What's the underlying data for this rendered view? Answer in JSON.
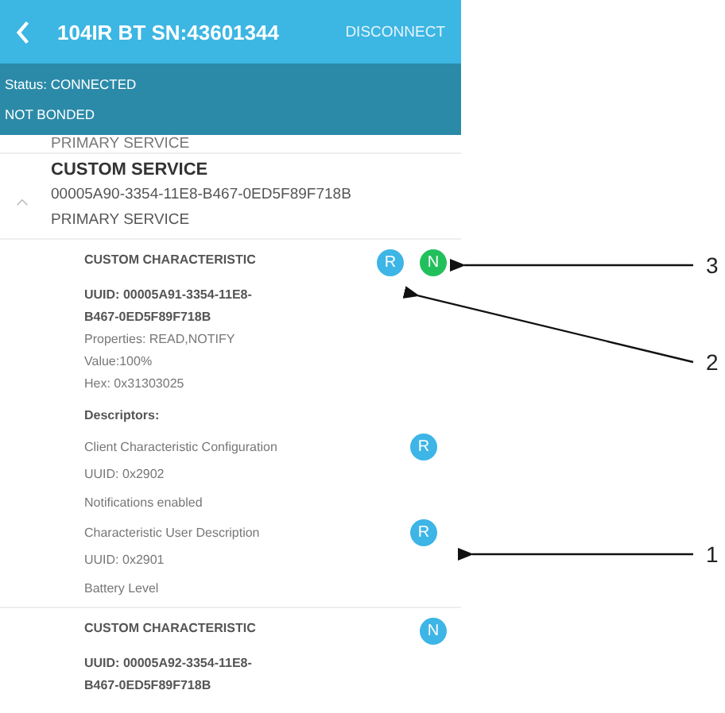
{
  "header": {
    "title": "104IR BT SN:43601344",
    "action": "DISCONNECT"
  },
  "status": [
    "Status: CONNECTED",
    "NOT BONDED"
  ],
  "partial_service_type": "PRIMARY SERVICE",
  "service": {
    "name": "CUSTOM SERVICE",
    "uuid": "00005A90-3354-11E8-B467-0ED5F89F718B",
    "type": "PRIMARY SERVICE",
    "expanded": true
  },
  "characteristics": [
    {
      "name": "CUSTOM CHARACTERISTIC",
      "badges": [
        {
          "letter": "R",
          "color": "#3db5e6"
        },
        {
          "letter": "N",
          "color": "#22c05c"
        }
      ],
      "uuid": [
        "UUID: 00005A91-3354-11E8-",
        "B467-0ED5F89F718B"
      ],
      "details": [
        "Properties: READ,NOTIFY",
        "Value:100%",
        "Hex: 0x31303025"
      ],
      "descriptors_title": "Descriptors:",
      "descriptors": [
        {
          "name": "Client Characteristic Configuration",
          "badge": {
            "letter": "R",
            "color": "#3db5e6"
          },
          "uuid": "UUID: 0x2902",
          "value": "Notifications enabled"
        },
        {
          "name": "Characteristic User Description",
          "badge": {
            "letter": "R",
            "color": "#3db5e6"
          },
          "uuid": "UUID: 0x2901",
          "value": "Battery Level"
        }
      ]
    },
    {
      "name": "CUSTOM CHARACTERISTIC",
      "badges": [
        {
          "letter": "N",
          "color": "#3db5e6"
        }
      ],
      "uuid": [
        "UUID: 00005A92-3354-11E8-",
        "B467-0ED5F89F718B"
      ]
    }
  ],
  "callouts": [
    "3",
    "2",
    "1"
  ]
}
